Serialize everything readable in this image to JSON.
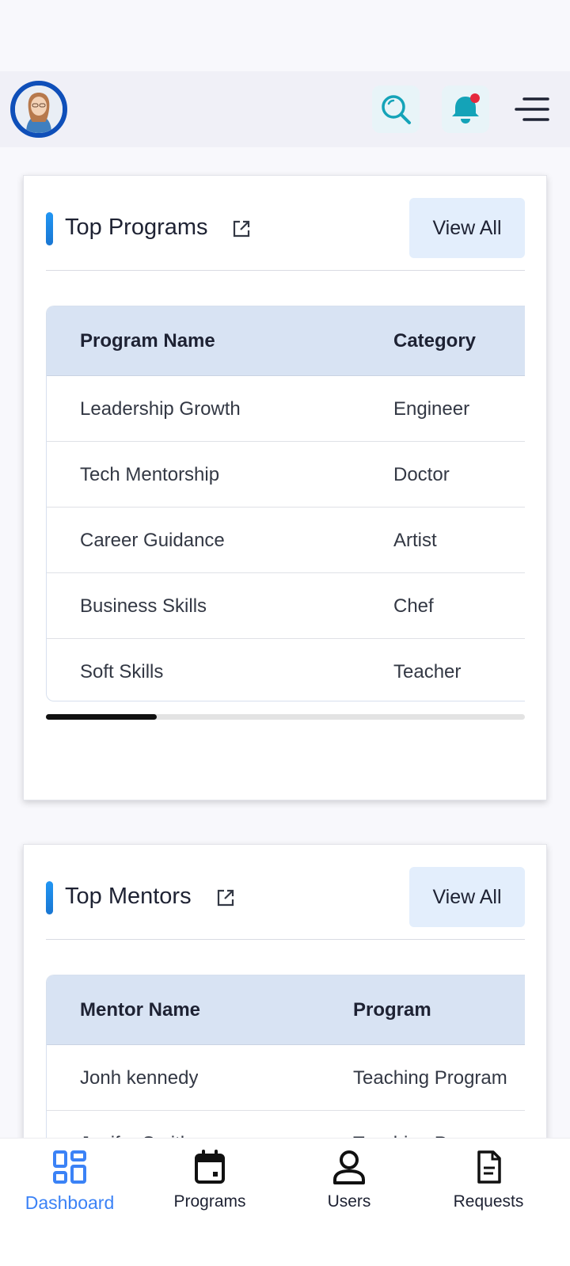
{
  "header": {
    "avatar_icon": "user-avatar",
    "search_icon": "search-icon",
    "bell_icon": "bell-icon",
    "menu_icon": "menu-icon",
    "colors": {
      "avatar_ring": "#0f4fb9",
      "icon_accent": "#14a3b8",
      "notification_dot": "#e5283c"
    }
  },
  "top_programs": {
    "title": "Top Programs",
    "view_all_label": "View All",
    "columns": [
      "Program Name",
      "Category"
    ],
    "rows": [
      [
        "Leadership Growth",
        "Engineer"
      ],
      [
        "Tech Mentorship",
        "Doctor"
      ],
      [
        "Career Guidance",
        "Artist"
      ],
      [
        "Business Skills",
        "Chef"
      ],
      [
        "Soft Skills",
        "Teacher"
      ]
    ]
  },
  "top_mentors": {
    "title": "Top Mentors",
    "view_all_label": "View All",
    "columns": [
      "Mentor Name",
      "Program"
    ],
    "rows": [
      [
        "Jonh kennedy",
        "Teaching Program"
      ],
      [
        "Jenifer Smith",
        "Teaching Program"
      ]
    ]
  },
  "bottom_nav": {
    "items": [
      {
        "label": "Dashboard",
        "icon": "dashboard-icon",
        "active": true
      },
      {
        "label": "Programs",
        "icon": "calendar-icon",
        "active": false
      },
      {
        "label": "Users",
        "icon": "user-icon",
        "active": false
      },
      {
        "label": "Requests",
        "icon": "document-icon",
        "active": false
      }
    ],
    "active_color": "#3b82f6"
  }
}
